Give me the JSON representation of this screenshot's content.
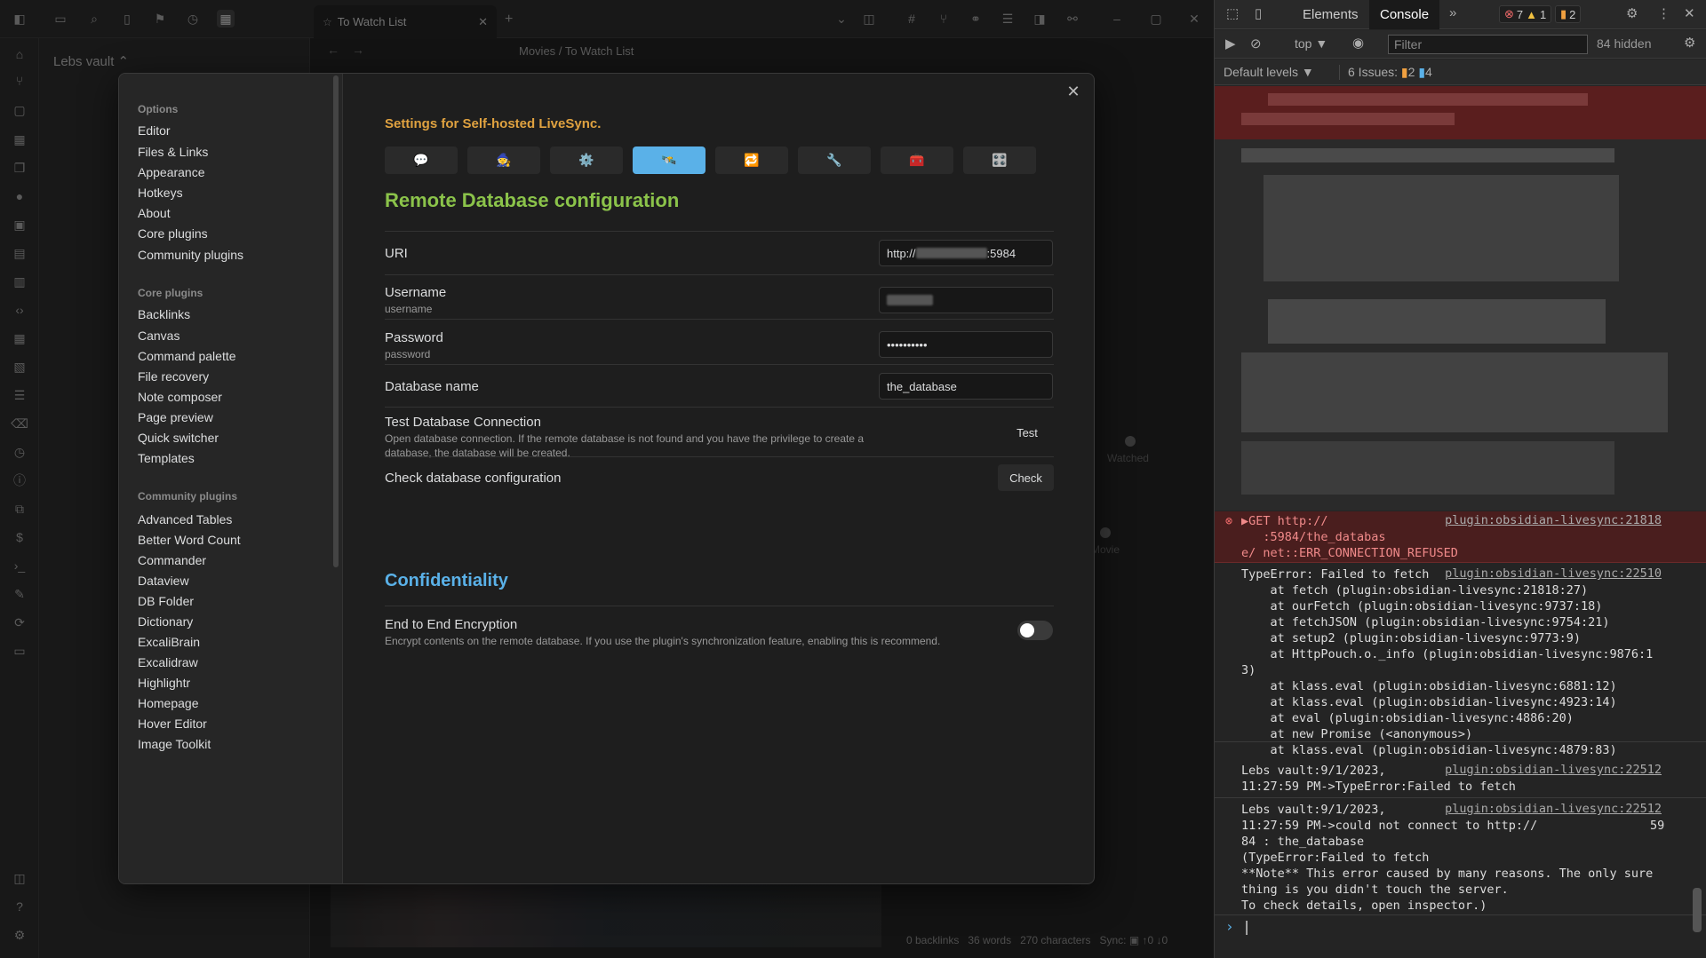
{
  "app": {
    "vault_name": "Lebs vault ⌃",
    "tab_title": "To Watch List",
    "breadcrumb": [
      "Movies",
      "/",
      "To Watch List"
    ]
  },
  "status_bar": {
    "backlinks": "0 backlinks",
    "words": "36 words",
    "characters": "270 characters",
    "sync": "Sync: ▣ ↑0 ↓0"
  },
  "graph_labels": {
    "watched": "Watched",
    "movie": "Movie"
  },
  "settings_nav": {
    "options_heading": "Options",
    "options": [
      "Editor",
      "Files & Links",
      "Appearance",
      "Hotkeys",
      "About",
      "Core plugins",
      "Community plugins"
    ],
    "core_heading": "Core plugins",
    "core": [
      "Backlinks",
      "Canvas",
      "Command palette",
      "File recovery",
      "Note composer",
      "Page preview",
      "Quick switcher",
      "Templates"
    ],
    "community_heading": "Community plugins",
    "community": [
      "Advanced Tables",
      "Better Word Count",
      "Commander",
      "Dataview",
      "DB Folder",
      "Dictionary",
      "ExcaliBrain",
      "Excalidraw",
      "Highlightr",
      "Homepage",
      "Hover Editor",
      "Image Toolkit"
    ]
  },
  "plugin": {
    "subtitle": "Settings for Self-hosted LiveSync.",
    "icon_tabs": [
      "💬",
      "🧙",
      "⚙️",
      "🛰️",
      "🔁",
      "🔧",
      "🧰",
      "🎛️"
    ],
    "heading_remote": "Remote Database configuration",
    "uri": {
      "label": "URI",
      "value_prefix": "http://",
      "value_suffix": ":5984"
    },
    "username": {
      "label": "Username",
      "desc": "username"
    },
    "password": {
      "label": "Password",
      "desc": "password",
      "value": "••••••••••"
    },
    "dbname": {
      "label": "Database name",
      "value": "the_database"
    },
    "test": {
      "label": "Test Database Connection",
      "desc": "Open database connection. If the remote database is not found and you have the privilege to create a database, the database will be created.",
      "button": "Test"
    },
    "check": {
      "label": "Check database configuration",
      "button": "Check"
    },
    "heading_conf": "Confidentiality",
    "e2e": {
      "label": "End to End Encryption",
      "desc": "Encrypt contents on the remote database. If you use the plugin's synchronization feature, enabling this is recommend.",
      "enabled": false
    }
  },
  "devtools": {
    "tabs": [
      "Elements",
      "Console"
    ],
    "badges": {
      "errors": "7",
      "warnings": "1",
      "issues": "2"
    },
    "context": "top ▼",
    "filter_placeholder": "Filter",
    "hidden": "84 hidden",
    "levels": "Default levels ▼",
    "issues_label": "6 Issues:",
    "issues_warn": "2",
    "issues_info": "4",
    "error_lines": [
      "▶GET http://",
      "   :5984/the_databas",
      "e/ net::ERR_CONNECTION_REFUSED"
    ],
    "error_src": "plugin:obsidian-livesync:21818",
    "typeerror_src": "plugin:obsidian-livesync:22510",
    "stack": [
      "TypeError: Failed to fetch",
      "    at fetch (plugin:obsidian-livesync:21818:27)",
      "    at ourFetch (plugin:obsidian-livesync:9737:18)",
      "    at fetchJSON (plugin:obsidian-livesync:9754:21)",
      "    at setup2 (plugin:obsidian-livesync:9773:9)",
      "    at HttpPouch.o._info (plugin:obsidian-livesync:9876:1",
      "3)",
      "    at klass.eval (plugin:obsidian-livesync:6881:12)",
      "    at klass.eval (plugin:obsidian-livesync:4923:14)",
      "    at eval (plugin:obsidian-livesync:4886:20)",
      "    at new Promise (<anonymous>)",
      "    at klass.eval (plugin:obsidian-livesync:4879:83)"
    ],
    "log1": [
      "Lebs vault:9/1/2023,",
      "11:27:59 PM->TypeError:Failed to fetch"
    ],
    "log1_src": "plugin:obsidian-livesync:22512",
    "log2": [
      "Lebs vault:9/1/2023,",
      "11:27:59 PM->could not connect to http://",
      "84 : the_database",
      "(TypeError:Failed to fetch",
      "**Note** This error caused by many reasons. The only sure",
      "thing is you didn't touch the server.",
      "To check details, open inspector.)"
    ],
    "log2_src": "plugin:obsidian-livesync:22512",
    "log2_tail": "59"
  },
  "colors": {
    "accent_blue": "#5ab1e8",
    "heading_green": "#8bc34a",
    "subtitle_orange": "#e0a240",
    "error_bg": "#4a1e1e"
  }
}
